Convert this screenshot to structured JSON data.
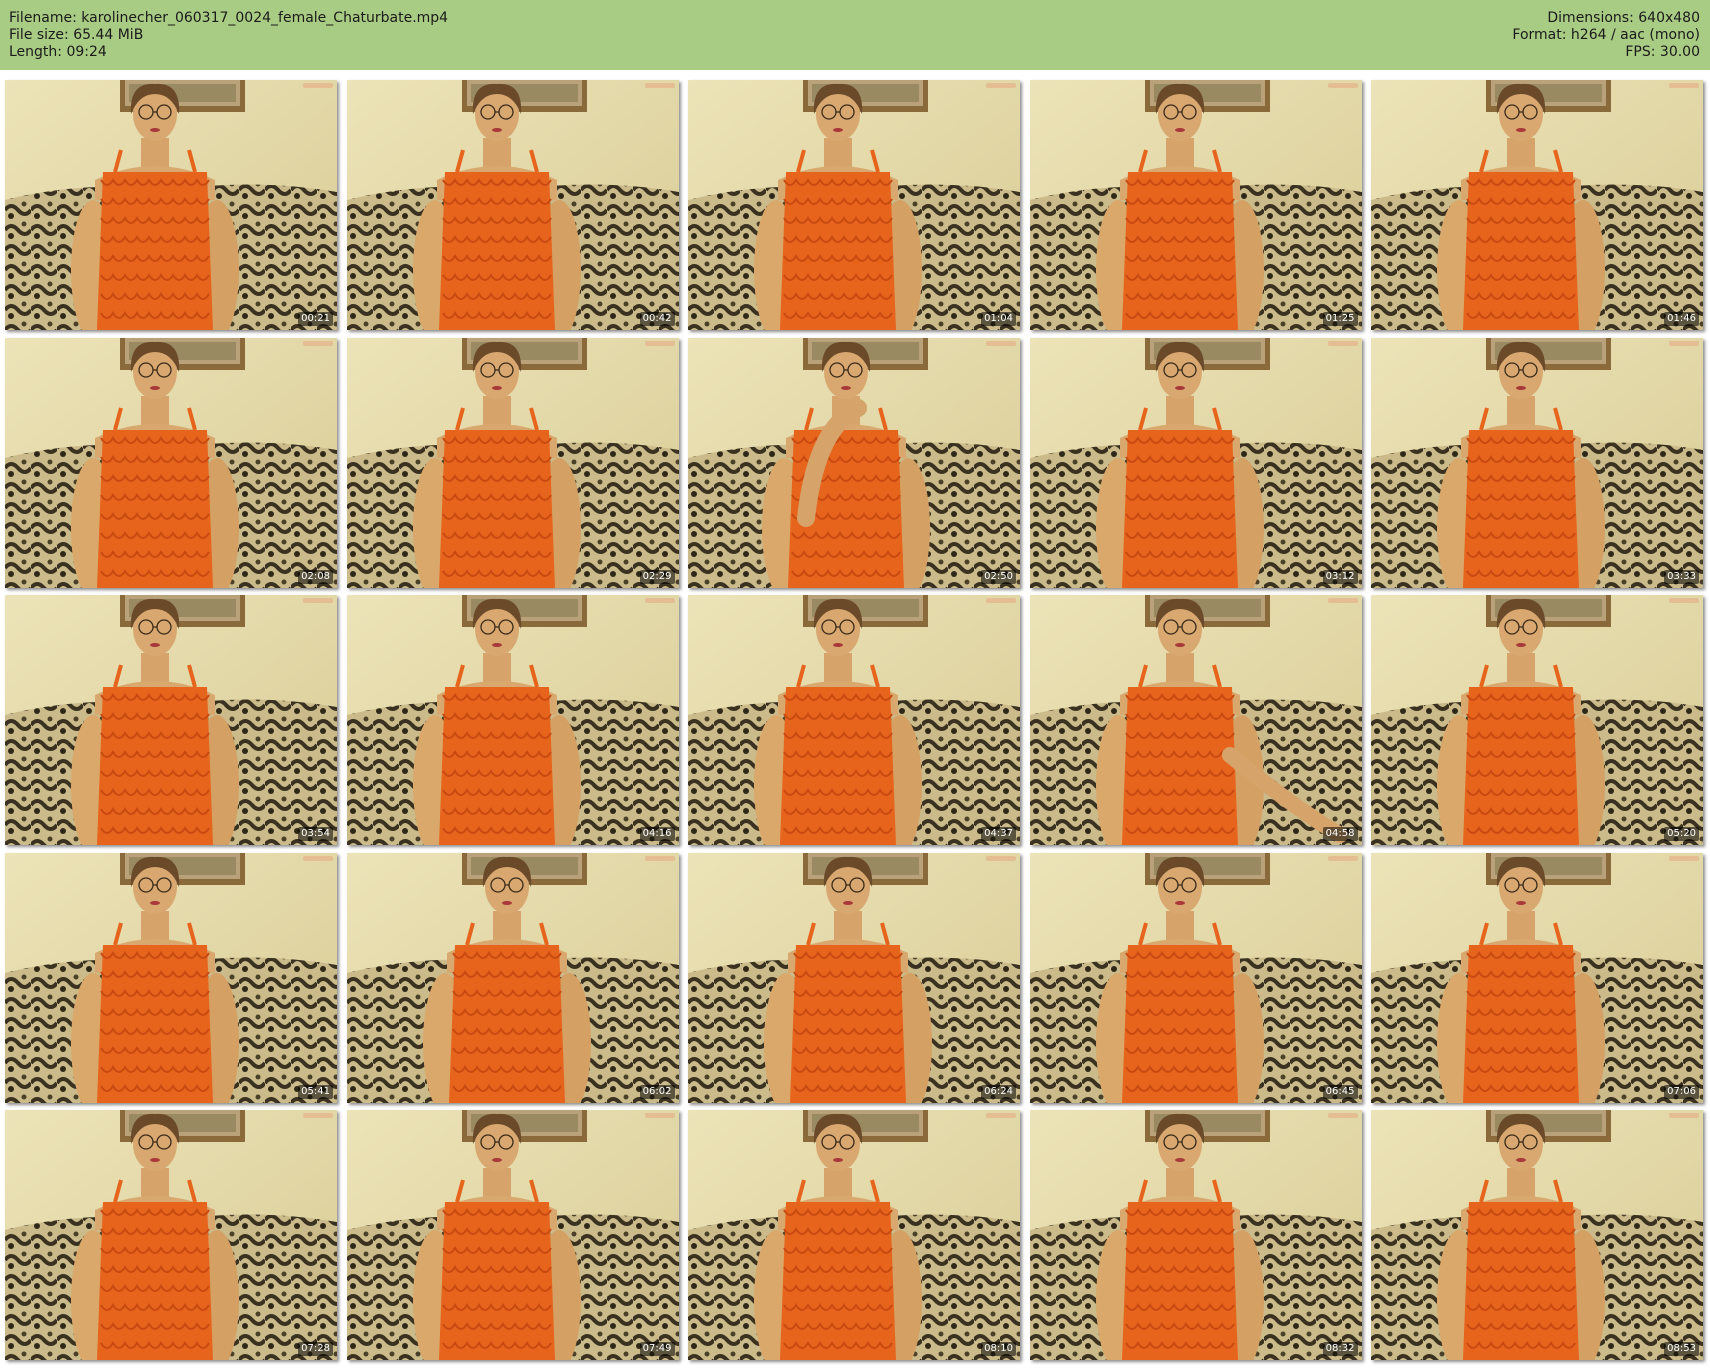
{
  "header": {
    "filename_line": "Filename: karolinecher_060317_0024_female_Chaturbate.mp4",
    "filesize_line": "File size: 65.44 MiB",
    "length_line": "Length: 09:24",
    "dimensions_line": "Dimensions: 640x480",
    "format_line": "Format: h264 / aac (mono)",
    "fps_line": "FPS: 30.00"
  },
  "colors": {
    "header_bg": "#a9cc84",
    "top_orange": "#e8661c",
    "wall": "#e6dcae",
    "sofa_dark": "#3b3320",
    "sofa_light": "#c9b98a"
  },
  "thumbnails": [
    {
      "time": "00:21",
      "pose": "center"
    },
    {
      "time": "00:42",
      "pose": "center"
    },
    {
      "time": "01:04",
      "pose": "center"
    },
    {
      "time": "01:25",
      "pose": "turned"
    },
    {
      "time": "01:46",
      "pose": "center"
    },
    {
      "time": "02:08",
      "pose": "center"
    },
    {
      "time": "02:29",
      "pose": "center"
    },
    {
      "time": "02:50",
      "pose": "hand-up"
    },
    {
      "time": "03:12",
      "pose": "center"
    },
    {
      "time": "03:33",
      "pose": "center"
    },
    {
      "time": "03:54",
      "pose": "center"
    },
    {
      "time": "04:16",
      "pose": "center"
    },
    {
      "time": "04:37",
      "pose": "center"
    },
    {
      "time": "04:58",
      "pose": "reaching"
    },
    {
      "time": "05:20",
      "pose": "center"
    },
    {
      "time": "05:41",
      "pose": "center"
    },
    {
      "time": "06:02",
      "pose": "leaning"
    },
    {
      "time": "06:24",
      "pose": "leaning"
    },
    {
      "time": "06:45",
      "pose": "center"
    },
    {
      "time": "07:06",
      "pose": "center"
    },
    {
      "time": "07:28",
      "pose": "center"
    },
    {
      "time": "07:49",
      "pose": "center"
    },
    {
      "time": "08:10",
      "pose": "center"
    },
    {
      "time": "08:32",
      "pose": "center"
    },
    {
      "time": "08:53",
      "pose": "center"
    }
  ]
}
